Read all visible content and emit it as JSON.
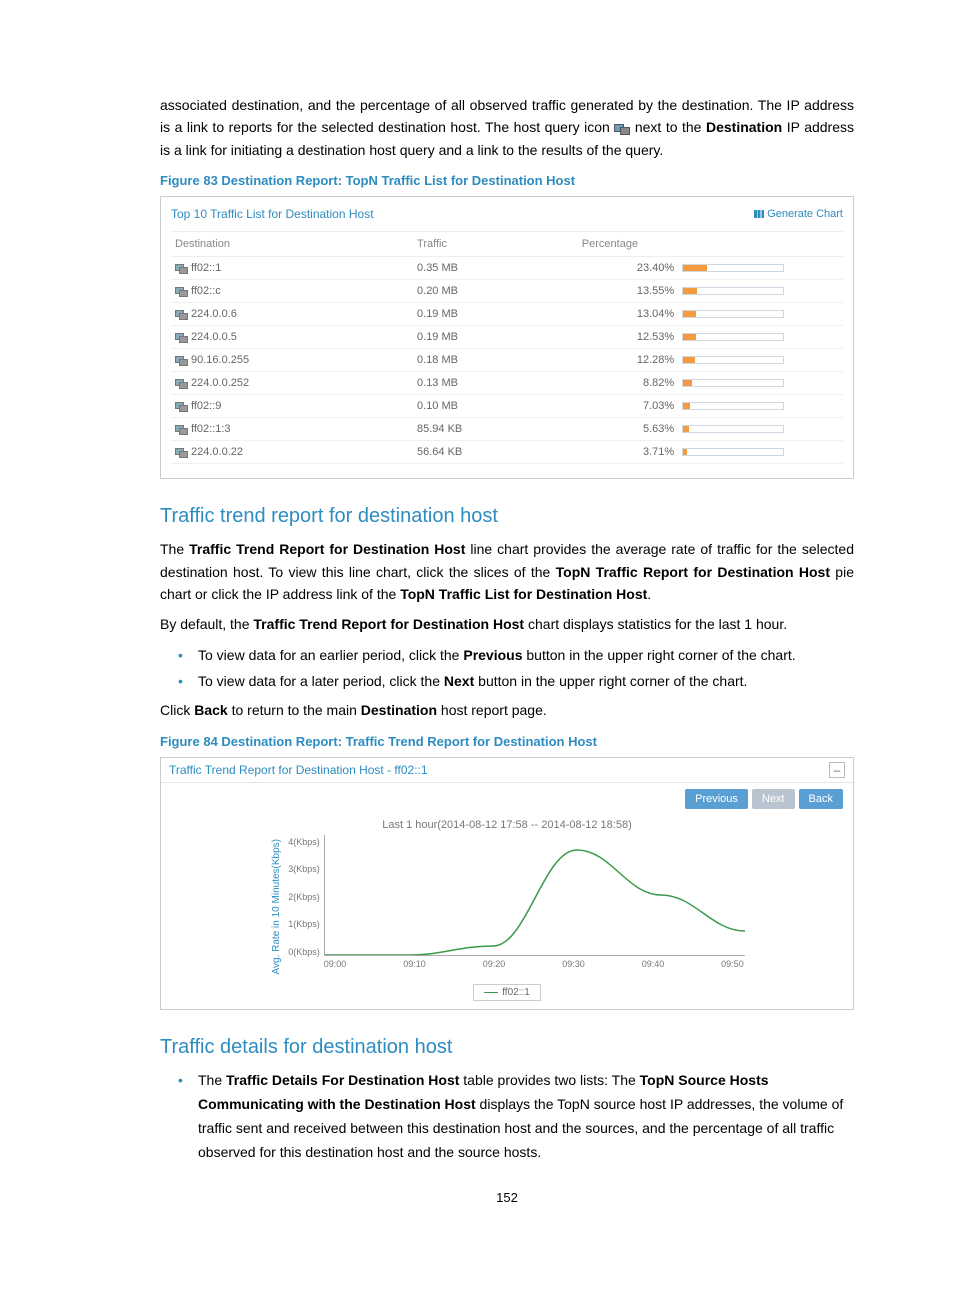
{
  "intro": {
    "p1a": "associated destination, and the percentage of all observed traffic generated by the destination. The IP address is a link to reports for the selected destination host. The host query icon ",
    "p1b": " next to the ",
    "p1c_bold": "Destination",
    "p1d": " IP address is a link for initiating a destination host query and a link to the results of the query."
  },
  "fig83": {
    "caption": "Figure 83 Destination Report: TopN Traffic List for Destination Host",
    "panel_title": "Top 10 Traffic List for Destination Host",
    "generate_chart": "Generate Chart",
    "columns": {
      "dest": "Destination",
      "traffic": "Traffic",
      "pct": "Percentage"
    },
    "rows": [
      {
        "dest": "ff02::1",
        "traffic": "0.35 MB",
        "pct": "23.40%",
        "fill": 23.4
      },
      {
        "dest": "ff02::c",
        "traffic": "0.20 MB",
        "pct": "13.55%",
        "fill": 13.55
      },
      {
        "dest": "224.0.0.6",
        "traffic": "0.19 MB",
        "pct": "13.04%",
        "fill": 13.04
      },
      {
        "dest": "224.0.0.5",
        "traffic": "0.19 MB",
        "pct": "12.53%",
        "fill": 12.53
      },
      {
        "dest": "90.16.0.255",
        "traffic": "0.18 MB",
        "pct": "12.28%",
        "fill": 12.28
      },
      {
        "dest": "224.0.0.252",
        "traffic": "0.13 MB",
        "pct": "8.82%",
        "fill": 8.82
      },
      {
        "dest": "ff02::9",
        "traffic": "0.10 MB",
        "pct": "7.03%",
        "fill": 7.03
      },
      {
        "dest": "ff02::1:3",
        "traffic": "85.94 KB",
        "pct": "5.63%",
        "fill": 5.63
      },
      {
        "dest": "224.0.0.22",
        "traffic": "56.64 KB",
        "pct": "3.71%",
        "fill": 3.71
      }
    ]
  },
  "section_trend": {
    "heading": "Traffic trend report for destination host",
    "p1_a": "The ",
    "p1_b": "Traffic Trend Report for Destination Host",
    "p1_c": " line chart provides the average rate of traffic for the selected destination host. To view this line chart, click the slices of the ",
    "p1_d": "TopN Traffic Report for Destination Host",
    "p1_e": " pie chart or click the IP address link of the ",
    "p1_f": "TopN Traffic List for Destination Host",
    "p1_g": ".",
    "p2_a": "By default, the ",
    "p2_b": "Traffic Trend Report for Destination Host",
    "p2_c": " chart displays statistics for the last 1 hour.",
    "b1_a": "To view data for an earlier period, click the ",
    "b1_b": "Previous",
    "b1_c": " button in the upper right corner of the chart.",
    "b2_a": "To view data for a later period, click the ",
    "b2_b": "Next",
    "b2_c": " button in the upper right corner of the chart.",
    "p3_a": "Click ",
    "p3_b": "Back",
    "p3_c": " to return to the main ",
    "p3_d": "Destination",
    "p3_e": " host report page."
  },
  "fig84": {
    "caption": "Figure 84 Destination Report: Traffic Trend Report for Destination Host",
    "panel_title": "Traffic Trend Report for Destination Host - ff02::1",
    "btn_prev": "Previous",
    "btn_next": "Next",
    "btn_back": "Back",
    "collapse": "–",
    "chart_caption": "Last 1 hour(2014-08-12 17:58 -- 2014-08-12 18:58)",
    "ylabel": "Avg. Rate in 10 Minutes(Kbps)",
    "yticks": [
      "4(Kbps)",
      "3(Kbps)",
      "2(Kbps)",
      "1(Kbps)",
      "0(Kbps)"
    ],
    "xticks": [
      "09:00",
      "09:10",
      "09:20",
      "09:30",
      "09:40",
      "09:50"
    ],
    "legend": "ff02::1"
  },
  "chart_data": {
    "type": "line",
    "title": "Last 1 hour(2014-08-12 17:58 -- 2014-08-12 18:58)",
    "xlabel": "",
    "ylabel": "Avg. Rate in 10 Minutes(Kbps)",
    "ylim": [
      0,
      4
    ],
    "x": [
      "09:00",
      "09:10",
      "09:20",
      "09:30",
      "09:40",
      "09:50"
    ],
    "series": [
      {
        "name": "ff02::1",
        "values": [
          0,
          0,
          0.3,
          3.5,
          2.0,
          0.8
        ]
      }
    ]
  },
  "section_details": {
    "heading": "Traffic details for destination host",
    "b1_a": "The ",
    "b1_b": "Traffic Details For Destination Host",
    "b1_c": " table provides two lists: The ",
    "b1_d": "TopN Source Hosts Communicating with the Destination Host",
    "b1_e": " displays the TopN source host IP addresses, the volume of traffic sent and received between this destination host and the sources, and the percentage of all traffic observed for this destination host and the source hosts."
  },
  "page_number": "152"
}
